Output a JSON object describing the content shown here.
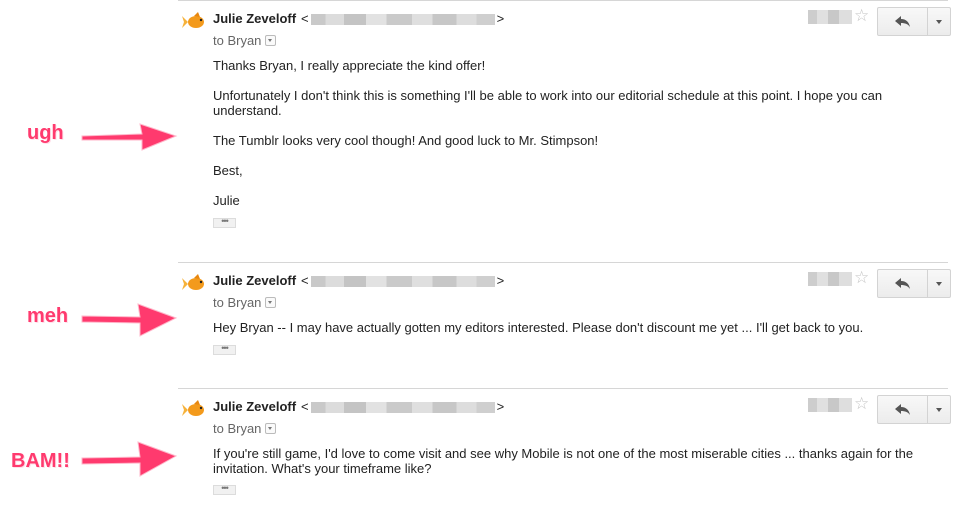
{
  "annotations": [
    {
      "label": "ugh"
    },
    {
      "label": "meh"
    },
    {
      "label": "BAM!!"
    }
  ],
  "messages": [
    {
      "sender": "Julie Zeveloff",
      "email_open": "<",
      "email_close": ">",
      "to_label": "to Bryan",
      "paragraphs": [
        "Thanks Bryan, I really appreciate the kind offer!",
        "Unfortunately I don't think this is something I'll be able to work into our editorial schedule at this point. I hope you can understand.",
        "The Tumblr looks very cool though! And good luck to Mr. Stimpson!",
        "Best,",
        "Julie"
      ],
      "show_trimmed": "•••"
    },
    {
      "sender": "Julie Zeveloff",
      "email_open": "<",
      "email_close": ">",
      "to_label": "to Bryan",
      "paragraphs": [
        "Hey Bryan -- I may have actually gotten my editors interested. Please don't discount me yet ... I'll get back to you."
      ],
      "show_trimmed": "•••"
    },
    {
      "sender": "Julie Zeveloff",
      "email_open": "<",
      "email_close": ">",
      "to_label": "to Bryan",
      "paragraphs": [
        "If you're still game, I'd love to come visit and see why Mobile is not one of the most miserable cities ... thanks again for the invitation. What's your timeframe like?"
      ],
      "show_trimmed": "•••"
    }
  ],
  "icons": {
    "avatar": "goldfish-avatar-icon",
    "star": "star-icon",
    "reply": "reply-arrow-icon",
    "more": "chevron-down-icon"
  },
  "colors": {
    "annotation": "#ff3a6e",
    "divider": "#d6d6d6"
  }
}
